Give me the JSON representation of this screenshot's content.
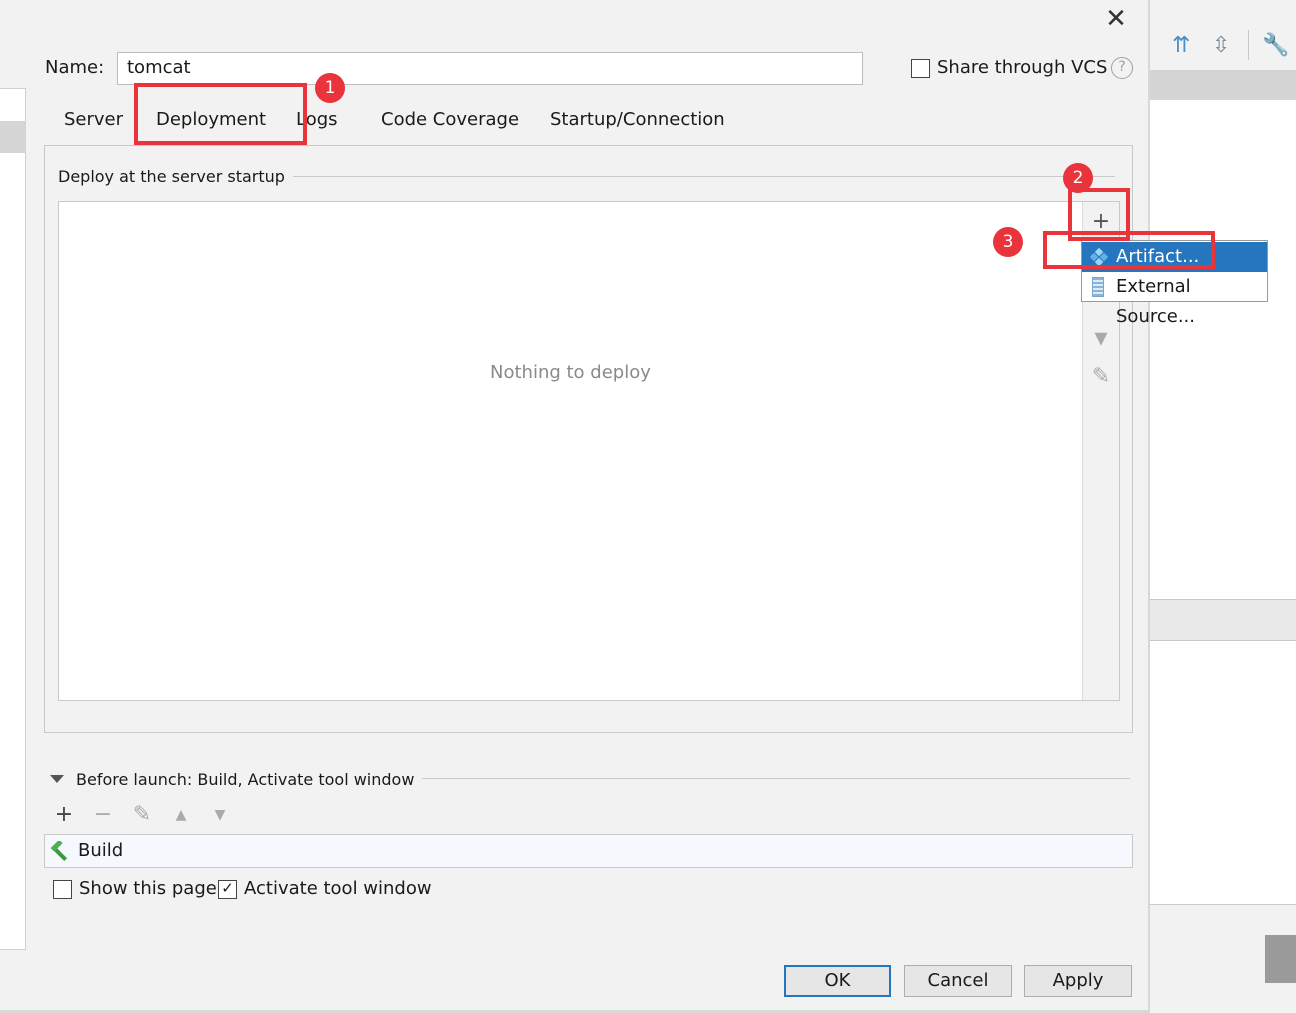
{
  "dialog": {
    "name_label": "Name:",
    "name_value": "tomcat",
    "share_vcs_label": "Share through VCS",
    "help_glyph": "?",
    "close_glyph": "✕"
  },
  "tabs": [
    {
      "label": "Server"
    },
    {
      "label": "Deployment"
    },
    {
      "label": "Logs"
    },
    {
      "label": "Code Coverage"
    },
    {
      "label": "Startup/Connection"
    }
  ],
  "deployment": {
    "section_title": "Deploy at the server startup",
    "empty_text": "Nothing to deploy",
    "toolbar": {
      "add": "+",
      "move_down": "▾",
      "edit": "✎"
    },
    "popup": {
      "items": [
        {
          "label": "Artifact...",
          "icon": "artifact-icon",
          "selected": true
        },
        {
          "label": "External Source...",
          "icon": "external-source-icon",
          "selected": false
        }
      ]
    }
  },
  "callouts": [
    "1",
    "2",
    "3"
  ],
  "before_launch": {
    "title": "Before launch: Build, Activate tool window",
    "toolbar": {
      "add": "+",
      "remove": "−",
      "edit": "✎",
      "up": "▲",
      "down": "▼"
    },
    "tasks": [
      {
        "label": "Build",
        "icon": "hammer-icon"
      }
    ],
    "show_this_page_label": "Show this page",
    "show_this_page_checked": false,
    "activate_tool_window_label": "Activate tool window",
    "activate_tool_window_checked": true
  },
  "buttons": {
    "ok": "OK",
    "cancel": "Cancel",
    "apply": "Apply"
  },
  "colors": {
    "callout": "#e8343a",
    "selection": "#2675bf"
  }
}
